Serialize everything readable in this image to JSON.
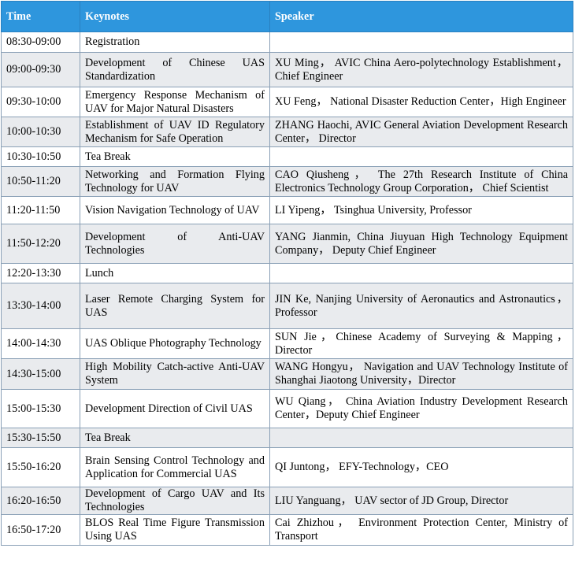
{
  "table": {
    "headers": [
      "Time",
      "Keynotes",
      "Speaker"
    ],
    "rows": [
      {
        "time": "08:30-09:00",
        "keynote": "Registration",
        "speaker": ""
      },
      {
        "time": "09:00-09:30",
        "keynote": "Development of Chinese UAS Standardization",
        "speaker": "XU Ming， AVIC China Aero-polytechnology Establishment， Chief Engineer"
      },
      {
        "time": "09:30-10:00",
        "keynote": "Emergency Response Mechanism of UAV for Major Natural Disasters",
        "speaker": "XU Feng， National Disaster Reduction Center，High Engineer"
      },
      {
        "time": "10:00-10:30",
        "keynote": "Establishment of UAV ID Regulatory Mechanism for Safe Operation",
        "speaker": "ZHANG Haochi, AVIC General Aviation Development Research Center， Director"
      },
      {
        "time": "10:30-10:50",
        "keynote": "Tea Break",
        "speaker": ""
      },
      {
        "time": "10:50-11:20",
        "keynote": "Networking and Formation Flying Technology for UAV",
        "speaker": "CAO Qiusheng， The 27th Research Institute of China Electronics Technology Group Corporation， Chief Scientist"
      },
      {
        "time": "11:20-11:50",
        "keynote": "Vision Navigation Technology of UAV",
        "speaker": "LI Yipeng， Tsinghua University, Professor"
      },
      {
        "time": "11:50-12:20",
        "keynote": "Development of Anti-UAV Technologies",
        "speaker": "YANG Jianmin, China Jiuyuan High Technology Equipment Company， Deputy Chief Engineer"
      },
      {
        "time": "12:20-13:30",
        "keynote": "Lunch",
        "speaker": ""
      },
      {
        "time": "13:30-14:00",
        "keynote": "Laser Remote Charging System for UAS",
        "speaker": "JIN Ke, Nanjing University of Aeronautics and Astronautics，Professor"
      },
      {
        "time": "14:00-14:30",
        "keynote": "UAS Oblique Photography Technology",
        "speaker": "SUN Jie，Chinese Academy of Surveying & Mapping，Director"
      },
      {
        "time": "14:30-15:00",
        "keynote": "High Mobility Catch-active Anti-UAV System",
        "speaker": "WANG Hongyu， Navigation and UAV Technology Institute of Shanghai Jiaotong University，Director"
      },
      {
        "time": "15:00-15:30",
        "keynote": "Development Direction of Civil UAS",
        "speaker": "WU Qiang， China Aviation Industry Development Research Center，Deputy Chief Engineer"
      },
      {
        "time": "15:30-15:50",
        "keynote": "Tea  Break",
        "speaker": ""
      },
      {
        "time": "15:50-16:20",
        "keynote": "Brain Sensing Control Technology and Application for Commercial UAS",
        "speaker": "QI Juntong， EFY-Technology，CEO"
      },
      {
        "time": "16:20-16:50",
        "keynote": "Development of Cargo UAV and Its Technologies",
        "speaker": "LIU Yanguang， UAV sector of JD Group, Director"
      },
      {
        "time": "16:50-17:20",
        "keynote": "BLOS Real Time Figure Transmission Using UAS",
        "speaker": "Cai Zhizhou， Environment Protection Center, Ministry of Transport"
      }
    ]
  }
}
